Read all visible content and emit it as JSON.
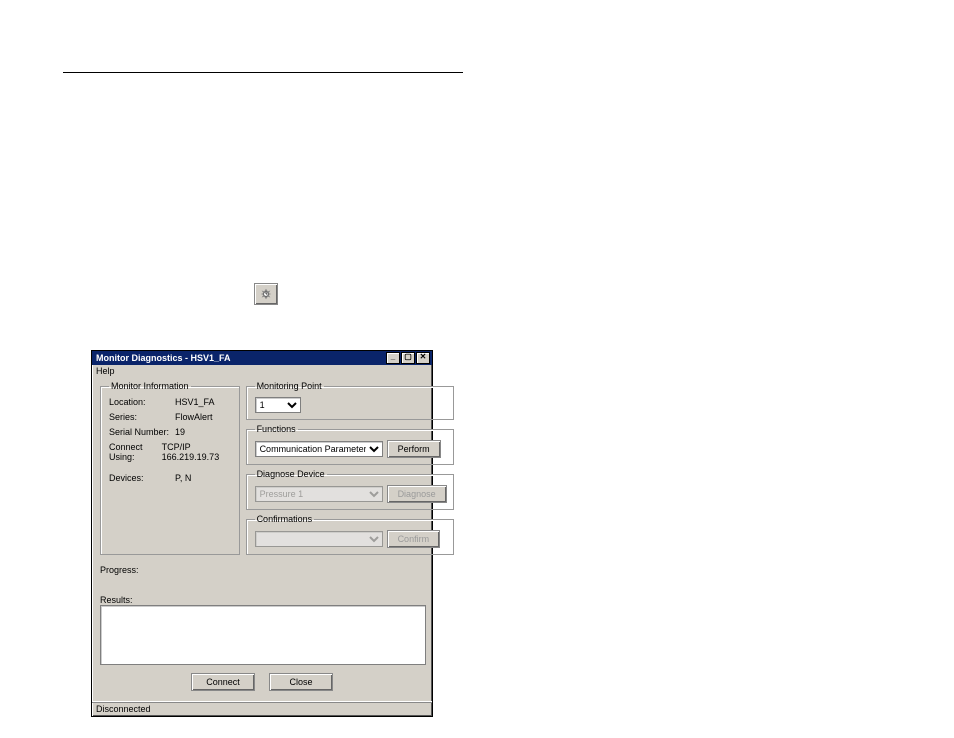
{
  "toolbar_icon": "diagnostics-icon",
  "window": {
    "title": "Monitor Diagnostics - HSV1_FA",
    "menu_help": "Help",
    "monitor_info": {
      "legend": "Monitor Information",
      "rows": [
        {
          "label": "Location:",
          "value": "HSV1_FA"
        },
        {
          "label": "Series:",
          "value": "FlowAlert"
        },
        {
          "label": "Serial Number:",
          "value": "19"
        },
        {
          "label": "Connect Using:",
          "value": "TCP/IP 166.219.19.73"
        },
        {
          "label": "Devices:",
          "value": "P, N"
        }
      ]
    },
    "monitoring_point": {
      "legend": "Monitoring Point",
      "value": "1"
    },
    "functions": {
      "legend": "Functions",
      "value": "Communication Parameters",
      "perform": "Perform"
    },
    "diagnose_device": {
      "legend": "Diagnose Device",
      "value": "Pressure 1",
      "diagnose": "Diagnose"
    },
    "confirmations": {
      "legend": "Confirmations",
      "value": "",
      "confirm": "Confirm"
    },
    "progress_label": "Progress:",
    "results_label": "Results:",
    "connect": "Connect",
    "close": "Close",
    "status": "Disconnected"
  }
}
